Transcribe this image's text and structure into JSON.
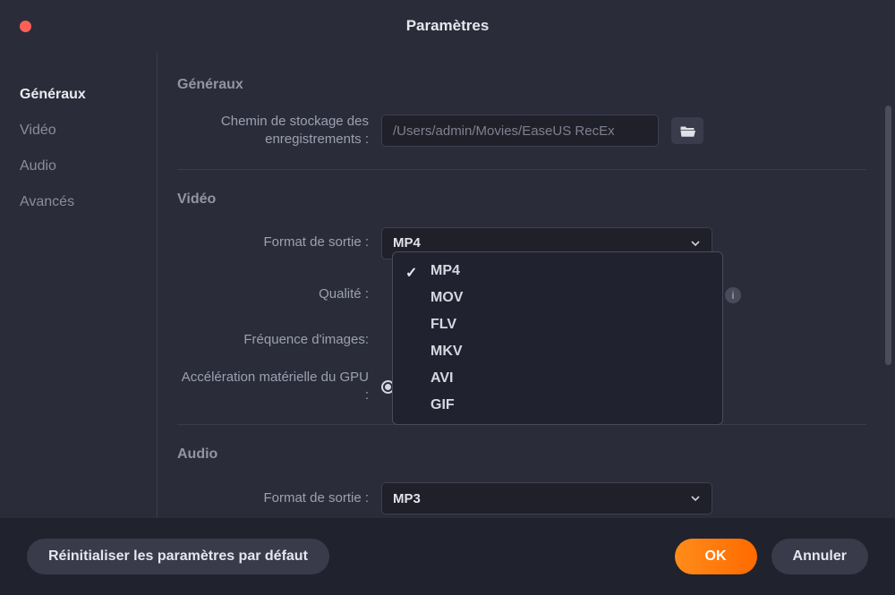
{
  "title": "Paramètres",
  "sidebar": {
    "items": [
      {
        "label": "Généraux",
        "active": true
      },
      {
        "label": "Vidéo",
        "active": false
      },
      {
        "label": "Audio",
        "active": false
      },
      {
        "label": "Avancés",
        "active": false
      }
    ]
  },
  "section_general": {
    "title": "Généraux",
    "storage_path_label": "Chemin de stockage des enregistrements :",
    "storage_path_value": "/Users/admin/Movies/EaseUS RecEx"
  },
  "section_video": {
    "title": "Vidéo",
    "format_label": "Format de sortie :",
    "format_value": "MP4",
    "format_options": [
      "MP4",
      "MOV",
      "FLV",
      "MKV",
      "AVI",
      "GIF"
    ],
    "quality_label": "Qualité :",
    "fps_label": "Fréquence d'images:",
    "gpu_label": "Accélération matérielle du GPU :"
  },
  "section_audio": {
    "title": "Audio",
    "format_label": "Format de sortie :",
    "format_value": "MP3"
  },
  "footer": {
    "reset_label": "Réinitialiser les paramètres par défaut",
    "ok_label": "OK",
    "cancel_label": "Annuler"
  }
}
